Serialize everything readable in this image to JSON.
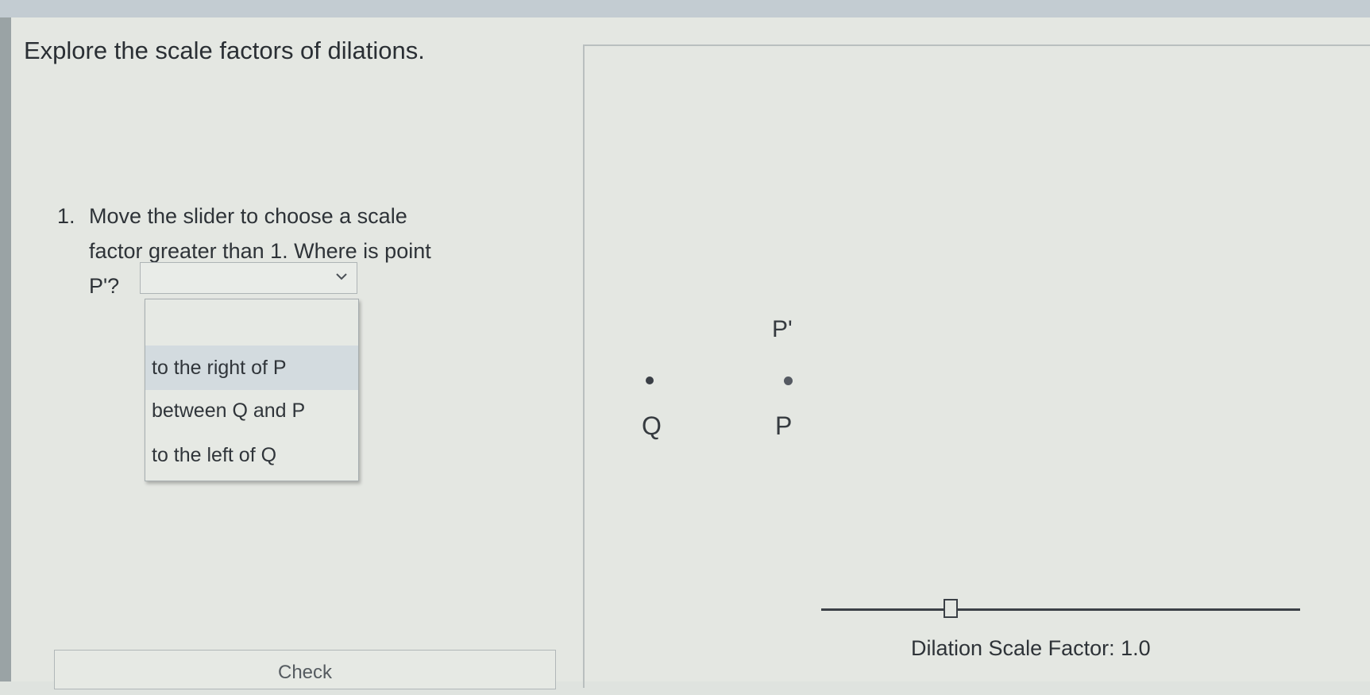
{
  "page": {
    "title": "Explore the scale factors of dilations."
  },
  "question": {
    "number": "1.",
    "line1": "Move the slider to choose a scale",
    "line2": "factor greater than 1. Where is point",
    "suffix": "P'?"
  },
  "dropdown": {
    "selected_value": "",
    "options": [
      {
        "label": ""
      },
      {
        "label": "to the right of P"
      },
      {
        "label": "between Q and P"
      },
      {
        "label": "to the left of Q"
      }
    ]
  },
  "canvas": {
    "points": {
      "p_prime_label": "P'",
      "q_label": "Q",
      "p_label": "P"
    },
    "slider": {
      "readout": "Dilation Scale Factor: 1.0",
      "value": 1.0
    }
  },
  "buttons": {
    "check_label": "Check"
  },
  "colors": {
    "background": "#e4e7e2",
    "highlight_option": "#d3dbdf",
    "text": "#2e3338"
  }
}
